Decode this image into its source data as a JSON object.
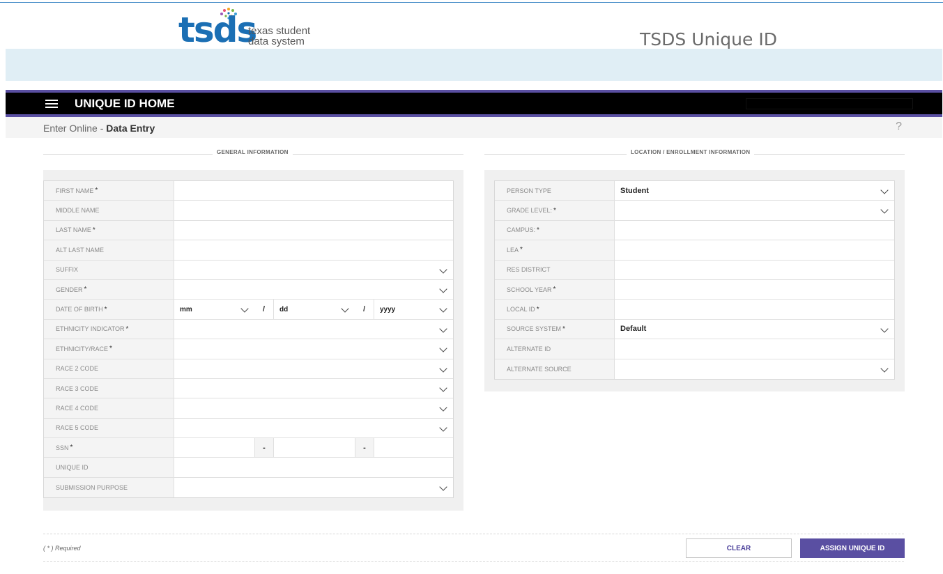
{
  "header": {
    "logo_word": "tsds",
    "logo_line1": "texas student",
    "logo_line2": "data system",
    "app_title": "TSDS Unique ID"
  },
  "nav": {
    "title": "UNIQUE ID HOME"
  },
  "breadcrumb": {
    "prefix": "Enter Online - ",
    "current": "Data Entry",
    "help": "?"
  },
  "general": {
    "heading": "GENERAL INFORMATION",
    "rows": [
      {
        "label": "FIRST NAME",
        "required": true,
        "value": ""
      },
      {
        "label": "MIDDLE NAME",
        "required": false,
        "value": ""
      },
      {
        "label": "LAST NAME",
        "required": true,
        "value": ""
      },
      {
        "label": "ALT LAST NAME",
        "required": false,
        "value": ""
      },
      {
        "label": "SUFFIX",
        "required": false,
        "value": ""
      },
      {
        "label": "GENDER",
        "required": true,
        "value": ""
      },
      {
        "label": "DATE OF BIRTH",
        "required": true,
        "mm": "mm",
        "dd": "dd",
        "yyyy": "yyyy",
        "sep": "/"
      },
      {
        "label": "ETHNICITY INDICATOR",
        "required": true,
        "value": ""
      },
      {
        "label": "ETHNICITY/RACE",
        "required": true,
        "value": ""
      },
      {
        "label": "RACE 2 CODE",
        "required": false,
        "value": ""
      },
      {
        "label": "RACE 3 CODE",
        "required": false,
        "value": ""
      },
      {
        "label": "RACE 4 CODE",
        "required": false,
        "value": ""
      },
      {
        "label": "RACE 5 CODE",
        "required": false,
        "value": ""
      },
      {
        "label": "SSN",
        "required": true,
        "dash": "-"
      },
      {
        "label": "UNIQUE ID",
        "required": false,
        "value": ""
      },
      {
        "label": "SUBMISSION PURPOSE",
        "required": false,
        "value": ""
      }
    ]
  },
  "location": {
    "heading": "LOCATION / ENROLLMENT INFORMATION",
    "rows": [
      {
        "label": "PERSON TYPE",
        "required": false,
        "value": "Student"
      },
      {
        "label": "GRADE LEVEL:",
        "required": true,
        "value": ""
      },
      {
        "label": "CAMPUS:",
        "required": true,
        "value": ""
      },
      {
        "label": "LEA",
        "required": true,
        "value": ""
      },
      {
        "label": "RES DISTRICT",
        "required": false,
        "value": ""
      },
      {
        "label": "SCHOOL YEAR",
        "required": true,
        "value": ""
      },
      {
        "label": "LOCAL ID",
        "required": true,
        "value": ""
      },
      {
        "label": "SOURCE SYSTEM",
        "required": true,
        "value": "Default"
      },
      {
        "label": "ALTERNATE ID",
        "required": false,
        "value": ""
      },
      {
        "label": "ALTERNATE SOURCE",
        "required": false,
        "value": ""
      }
    ]
  },
  "footer": {
    "required_note": "( * ) Required",
    "clear_label": "CLEAR",
    "assign_label": "ASSIGN UNIQUE ID"
  },
  "colors": {
    "accent": "#5a4fa2",
    "logo_blue": "#1b6fb4",
    "band": "#e0eef5"
  }
}
